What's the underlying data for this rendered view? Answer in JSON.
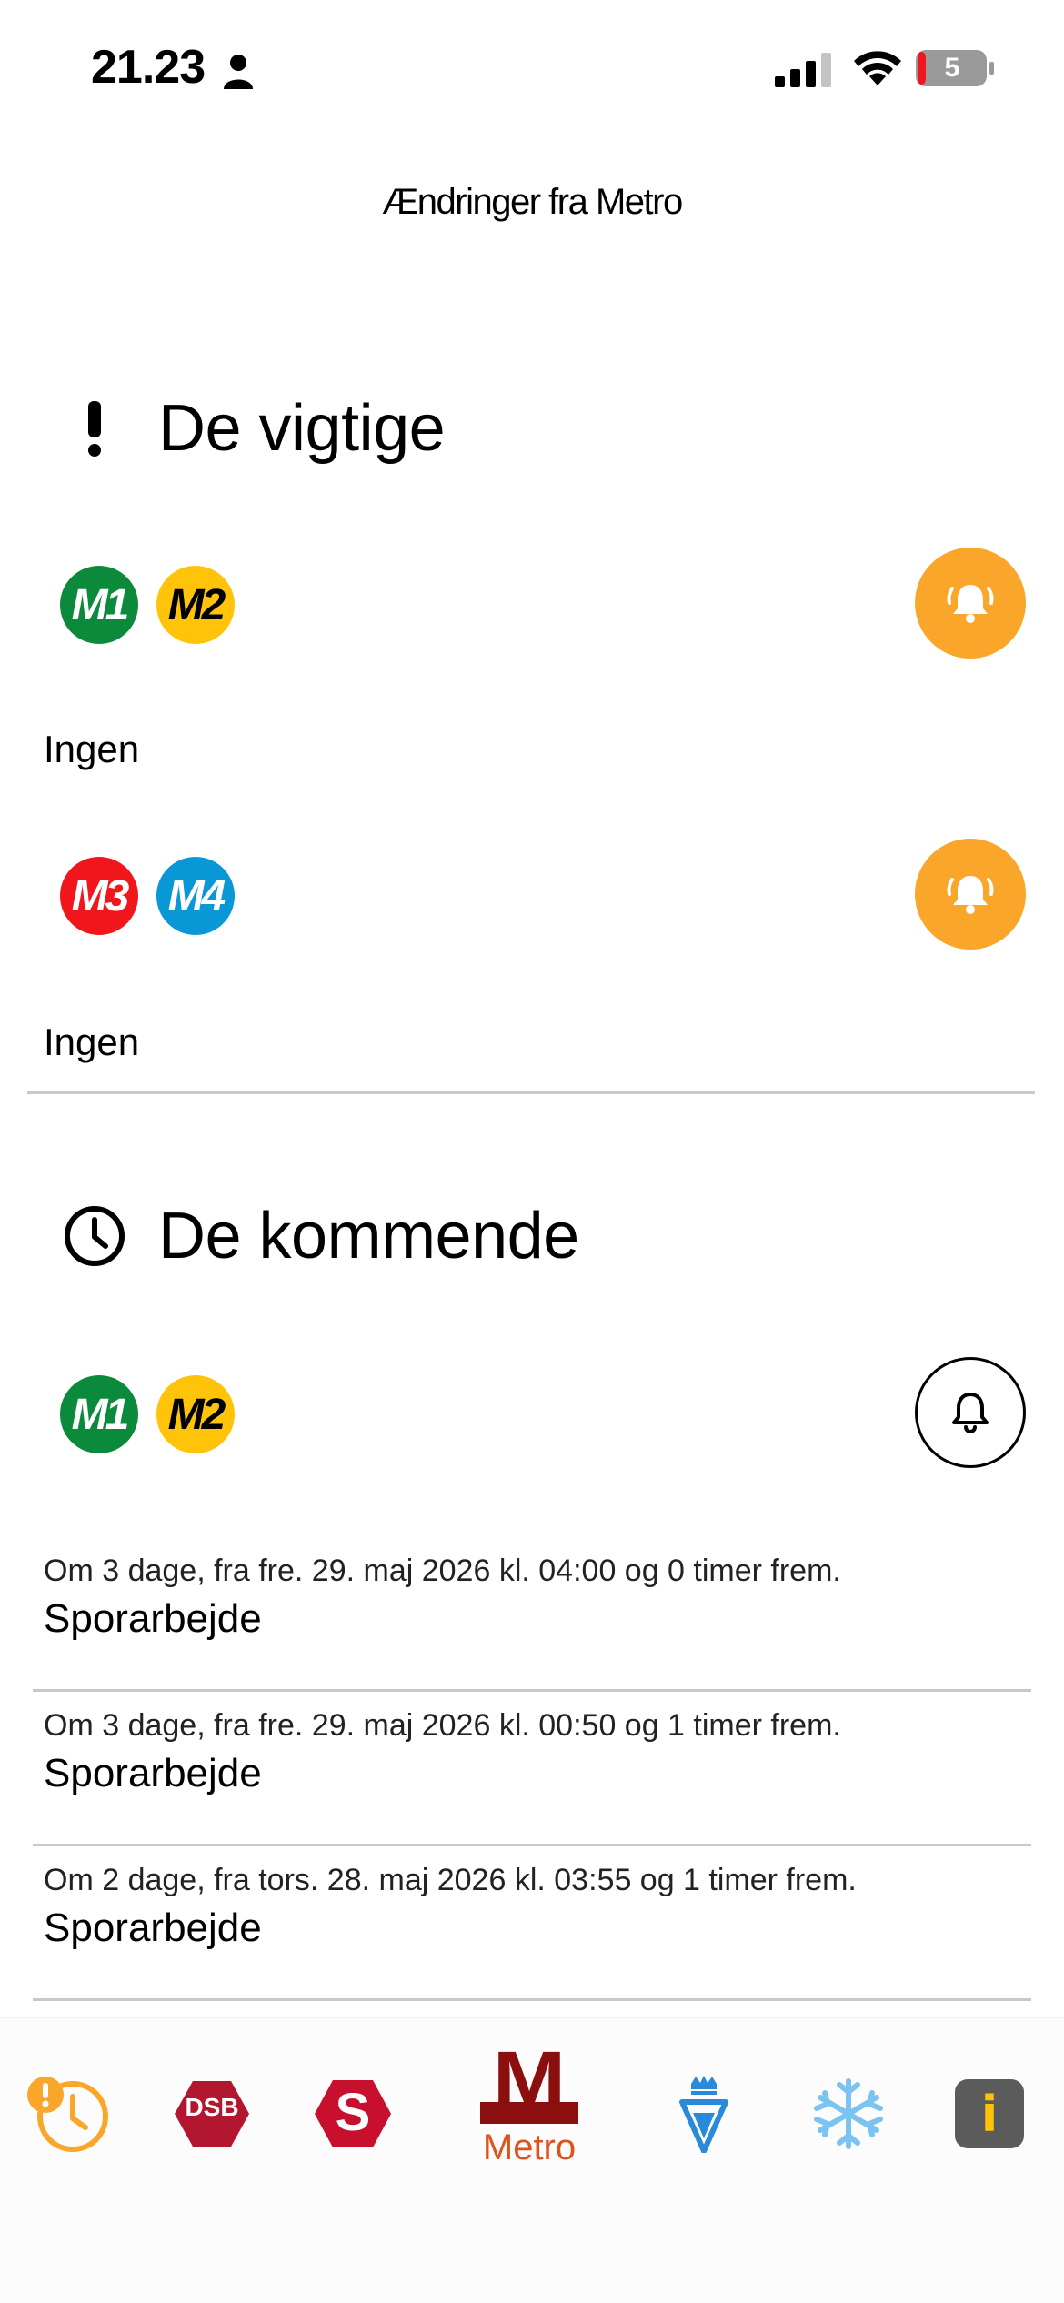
{
  "status_bar": {
    "time": "21.23",
    "battery_level": "5"
  },
  "nav": {
    "title": "Ændringer fra Metro"
  },
  "important": {
    "title": "De vigtige",
    "groups": [
      {
        "lines": [
          "M1",
          "M2"
        ],
        "empty_text": "Ingen"
      },
      {
        "lines": [
          "M3",
          "M4"
        ],
        "empty_text": "Ingen"
      }
    ]
  },
  "upcoming": {
    "title": "De kommende",
    "lines": [
      "M1",
      "M2"
    ],
    "items": [
      {
        "meta": "Om 3 dage, fra fre. 29. maj 2026 kl. 04:00 og 0 timer frem.",
        "title": "Sporarbejde"
      },
      {
        "meta": "Om 3 dage, fra fre. 29. maj 2026 kl. 00:50 og 1 timer frem.",
        "title": "Sporarbejde"
      },
      {
        "meta": "Om 2 dage, fra tors. 28. maj 2026 kl. 03:55 og 1 timer frem.",
        "title": "Sporarbejde"
      }
    ]
  },
  "tab_bar": {
    "dsb_label": "DSB",
    "stog_label": "S",
    "metro_logo": "M",
    "metro_label": "Metro",
    "info_label": "i"
  },
  "colors": {
    "M1": "#0A8A3A",
    "M2": "#FFC409",
    "M3": "#F0161B",
    "M4": "#0997D5",
    "bell_active": "#FAA62A",
    "accent": "#E0521B",
    "metro_red": "#8B0F0F",
    "dsb_red": "#B3162F"
  }
}
